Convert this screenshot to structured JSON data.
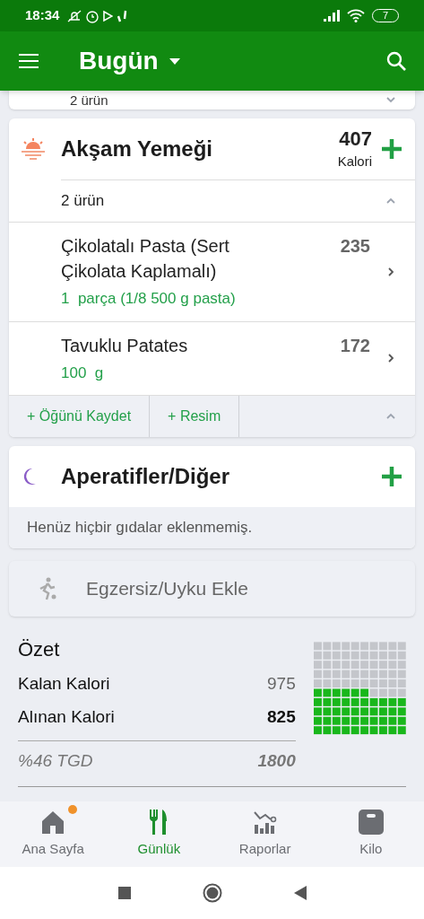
{
  "status_bar": {
    "time": "18:34",
    "battery": "7"
  },
  "app_bar": {
    "title": "Bugün"
  },
  "previous_meal": {
    "items_label": "2 ürün"
  },
  "meals": [
    {
      "kind": "dinner",
      "title": "Akşam Yemeği",
      "calories": "407",
      "calories_unit": "Kalori",
      "items_label": "2 ürün",
      "expanded": true,
      "items": [
        {
          "name": "Çikolatalı Pasta (Sert Çikolata Kaplamalı)",
          "calories": "235",
          "portion": "1  parça (1/8 500 g pasta)"
        },
        {
          "name": "Tavuklu Patates",
          "calories": "172",
          "portion": "100  g"
        }
      ],
      "actions": [
        "+ Öğünü Kaydet",
        "+ Resim"
      ]
    },
    {
      "kind": "snack",
      "title": "Aperatifler/Diğer",
      "empty_text": "Henüz hiçbir gıdalar eklenmemiş."
    }
  ],
  "exercise": {
    "label": "Egzersiz/Uyku Ekle"
  },
  "summary": {
    "title": "Özet",
    "rows": [
      {
        "label": "Kalan Kalori",
        "value": "975",
        "bold": false
      },
      {
        "label": "Alınan Kalori",
        "value": "825",
        "bold": true
      }
    ],
    "goal_label": "%46 TGD",
    "goal_value": "1800",
    "level": 0.46
  },
  "bottom_nav": [
    {
      "kind": "home",
      "label": "Ana Sayfa",
      "selected": false,
      "badge": true
    },
    {
      "kind": "diary",
      "label": "Günlük",
      "selected": true,
      "badge": false
    },
    {
      "kind": "reports",
      "label": "Raporlar",
      "selected": false,
      "badge": false
    },
    {
      "kind": "weight",
      "label": "Kilo",
      "selected": false,
      "badge": false
    }
  ]
}
